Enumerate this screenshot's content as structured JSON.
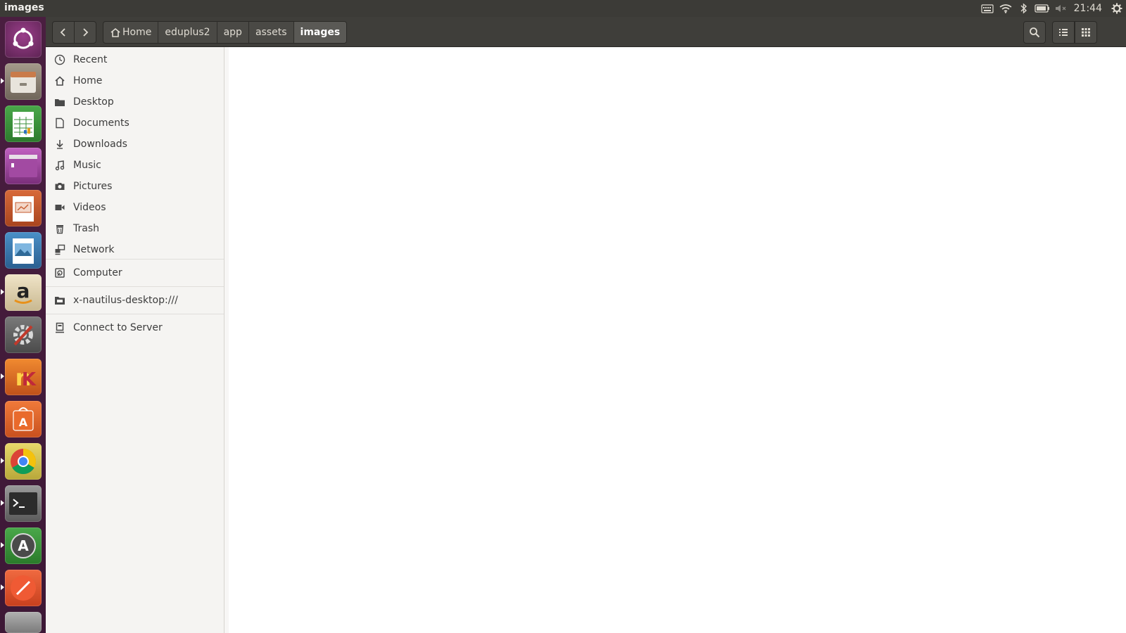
{
  "window": {
    "title": "images"
  },
  "top_panel": {
    "clock": "21:44",
    "indicators": [
      "keyboard-icon",
      "wifi-icon",
      "bluetooth-icon",
      "battery-icon",
      "volume-muted-icon",
      "gear-icon"
    ]
  },
  "toolbar": {
    "breadcrumbs": [
      {
        "label": "Home",
        "icon": "home-icon"
      },
      {
        "label": "eduplus2"
      },
      {
        "label": "app"
      },
      {
        "label": "assets"
      },
      {
        "label": "images"
      }
    ]
  },
  "sidebar": {
    "places": [
      {
        "label": "Recent",
        "icon": "clock-icon"
      },
      {
        "label": "Home",
        "icon": "home-icon"
      },
      {
        "label": "Desktop",
        "icon": "folder-icon"
      },
      {
        "label": "Documents",
        "icon": "document-icon"
      },
      {
        "label": "Downloads",
        "icon": "download-icon"
      },
      {
        "label": "Music",
        "icon": "music-icon"
      },
      {
        "label": "Pictures",
        "icon": "camera-icon"
      },
      {
        "label": "Videos",
        "icon": "video-icon"
      },
      {
        "label": "Trash",
        "icon": "trash-icon"
      },
      {
        "label": "Network",
        "icon": "network-icon"
      }
    ],
    "devices": [
      {
        "label": "Computer",
        "icon": "computer-icon"
      }
    ],
    "bookmarks": [
      {
        "label": "x-nautilus-desktop:///",
        "icon": "desktop-folder-icon"
      }
    ],
    "other": [
      {
        "label": "Connect to Server",
        "icon": "server-icon"
      }
    ]
  },
  "launcher": {
    "items": [
      "ubuntu-dash-icon",
      "files-icon",
      "libreoffice-calc-icon",
      "app-window-icon",
      "libreoffice-impress-icon",
      "image-viewer-icon",
      "amazon-icon",
      "system-settings-icon",
      "app-icon",
      "software-center-icon",
      "chrome-icon",
      "terminal-icon",
      "software-updater-icon",
      "editor-icon",
      "trash-launcher-icon"
    ]
  }
}
